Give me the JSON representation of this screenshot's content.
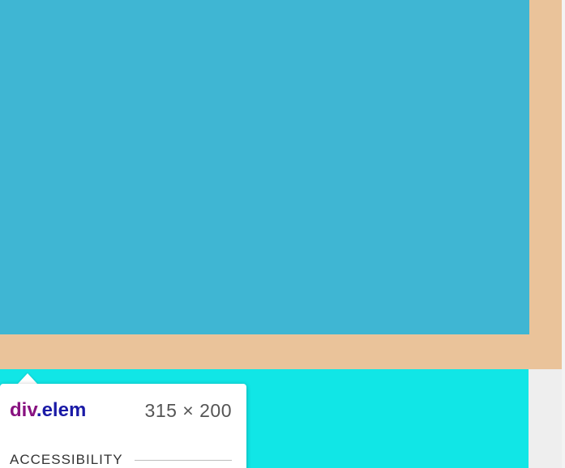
{
  "colors": {
    "content_box": "#3fb6d3",
    "margin_overlay": "#eac39a",
    "below_area": "#11e6e6",
    "page_background": "#f1f1f1"
  },
  "tooltip": {
    "selector_tag": "div",
    "selector_class": ".elem",
    "dimensions": "315 × 200",
    "section_title": "ACCESSIBILITY"
  }
}
